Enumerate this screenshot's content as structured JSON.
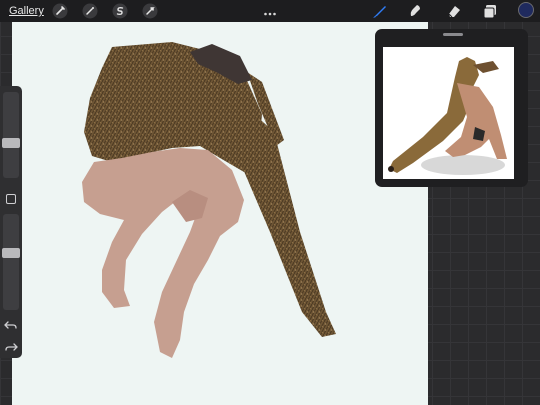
{
  "topbar": {
    "gallery_label": "Gallery",
    "actions_icon": "wrench-icon",
    "adjustments_icon": "magic-wand-icon",
    "selection_icon": "selection-s-icon",
    "transform_icon": "arrow-cursor-icon",
    "more_icon": "ellipsis-icon",
    "brush_icon": "brush-icon",
    "smudge_icon": "smudge-icon",
    "eraser_icon": "eraser-icon",
    "layers_icon": "layers-icon",
    "active_color": "#1f2a5e",
    "brush_active_color": "#2f7df6"
  },
  "sidebar": {
    "brush_size_level": 0.4,
    "opacity_level": 0.6,
    "modifier_icon": "square-modifier-icon",
    "undo_icon": "undo-icon",
    "redo_icon": "redo-icon"
  },
  "reference": {
    "grabber_icon": "drag-handle-icon"
  }
}
